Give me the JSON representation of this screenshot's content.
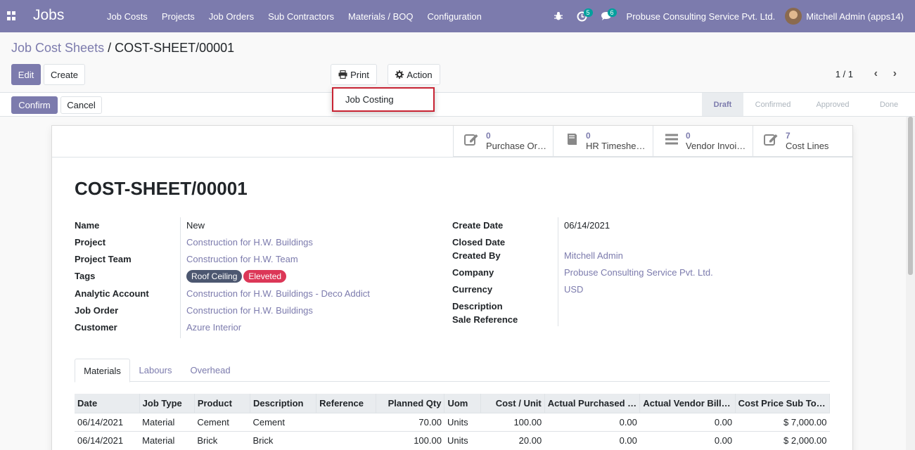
{
  "navbar": {
    "brand": "Jobs",
    "menu": [
      "Job Costs",
      "Projects",
      "Job Orders",
      "Sub Contractors",
      "Materials / BOQ",
      "Configuration"
    ],
    "activity_count": "5",
    "messages_count": "6",
    "company": "Probuse Consulting Service Pvt. Ltd.",
    "user": "Mitchell Admin (apps14)"
  },
  "breadcrumb": {
    "parent": "Job Cost Sheets",
    "separator": "/",
    "current": "COST-SHEET/00001"
  },
  "buttons": {
    "edit": "Edit",
    "create": "Create",
    "print": "Print",
    "action": "Action",
    "confirm": "Confirm",
    "cancel": "Cancel"
  },
  "pager": "1 / 1",
  "print_menu": [
    "Job Costing"
  ],
  "stages": [
    {
      "label": "Draft",
      "active": true
    },
    {
      "label": "Confirmed",
      "active": false
    },
    {
      "label": "Approved",
      "active": false
    },
    {
      "label": "Done",
      "active": false
    }
  ],
  "smart_buttons": [
    {
      "value": "0",
      "label": "Purchase Or…",
      "icon": "edit-icon"
    },
    {
      "value": "0",
      "label": "HR Timeshe…",
      "icon": "book-icon"
    },
    {
      "value": "0",
      "label": "Vendor Invoi…",
      "icon": "list-icon"
    },
    {
      "value": "7",
      "label": "Cost Lines",
      "icon": "edit-icon"
    }
  ],
  "record": {
    "title": "COST-SHEET/00001",
    "left_labels": {
      "name": "Name",
      "project": "Project",
      "project_team": "Project Team",
      "tags": "Tags",
      "analytic_account": "Analytic Account",
      "job_order": "Job Order",
      "customer": "Customer"
    },
    "left_values": {
      "name": "New",
      "project": "Construction for H.W. Buildings",
      "project_team": "Construction for H.W. Team",
      "analytic_account": "Construction for H.W. Buildings - Deco Addict",
      "job_order": "Construction for H.W. Buildings",
      "customer": "Azure Interior"
    },
    "tags": [
      {
        "label": "Roof Ceiling",
        "color": "#4c5770"
      },
      {
        "label": "Eleveted",
        "color": "#dc3757"
      }
    ],
    "right_labels": {
      "create_date": "Create Date",
      "closed_date": "Closed Date",
      "created_by": "Created By",
      "company": "Company",
      "currency": "Currency",
      "description": "Description",
      "sale_reference": "Sale Reference"
    },
    "right_values": {
      "create_date": "06/14/2021",
      "created_by": "Mitchell Admin",
      "company": "Probuse Consulting Service Pvt. Ltd.",
      "currency": "USD"
    }
  },
  "tabs": [
    "Materials",
    "Labours",
    "Overhead"
  ],
  "table": {
    "headers": [
      "Date",
      "Job Type",
      "Product",
      "Description",
      "Reference",
      "Planned Qty",
      "Uom",
      "Cost / Unit",
      "Actual Purchased …",
      "Actual Vendor Bill…",
      "Cost Price Sub To…"
    ],
    "rows": [
      [
        "06/14/2021",
        "Material",
        "Cement",
        "Cement",
        "",
        "70.00",
        "Units",
        "100.00",
        "0.00",
        "0.00",
        "$ 7,000.00"
      ],
      [
        "06/14/2021",
        "Material",
        "Brick",
        "Brick",
        "",
        "100.00",
        "Units",
        "20.00",
        "0.00",
        "0.00",
        "$ 2,000.00"
      ]
    ]
  }
}
